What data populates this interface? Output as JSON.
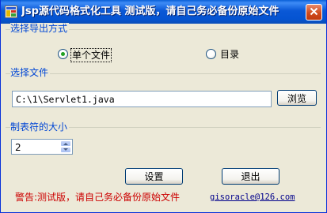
{
  "window": {
    "title": "Jsp源代码格式化工具 测试版，请自己务必备份原始文件",
    "accent": "#0a58d6"
  },
  "export_mode": {
    "label": "选择导出方式",
    "options": [
      "单个文件",
      "目录"
    ],
    "selected": "单个文件"
  },
  "file": {
    "label": "选择文件",
    "path": "C:\\1\\Servlet1.java",
    "browse_label": "浏览"
  },
  "tab_size": {
    "label": "制表符的大小",
    "value": "2"
  },
  "actions": {
    "settings_label": "设置",
    "exit_label": "退出"
  },
  "footer": {
    "warning": "警告:测试版，请自己务必备份原始文件",
    "email": "gisoracle@126.com",
    "warning_color": "#cc0000"
  }
}
